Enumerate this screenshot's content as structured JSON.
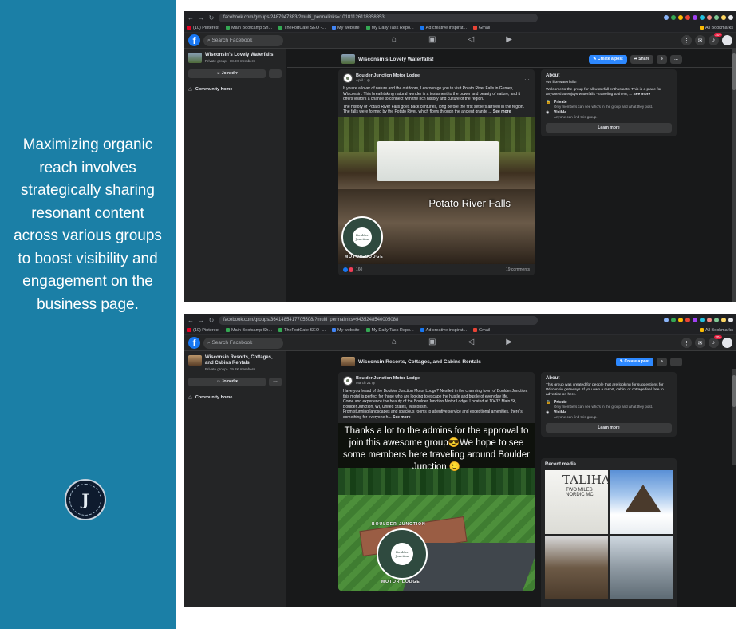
{
  "caption": "Maximizing organic reach involves strategically sharing resonant content across various groups to boost visibility and engagement on the business page.",
  "colors": {
    "panel": "#1b7fa6",
    "fb_blue": "#1877f2",
    "dark_bg": "#18191a",
    "card": "#242526"
  },
  "screenshot1": {
    "url": "facebook.com/groups/2487947383/?multi_permalinks=10181126118858853",
    "search_placeholder": "Search Facebook",
    "notif_count": "20+",
    "sidebar": {
      "group_name": "Wisconsin's Lovely Waterfalls!",
      "group_meta": "Private group · 18.9K members",
      "joined_label": "Joined",
      "community_home": "Community home"
    },
    "header": {
      "group_name": "Wisconsin's Lovely Waterfalls!",
      "create_post": "Create a post",
      "share": "Share"
    },
    "post": {
      "author": "Boulder Junction Motor Lodge",
      "date": "April 1",
      "text1": "If you're a lover of nature and the outdoors, I encourage you to visit Potato River Falls in Gurney, Wisconsin. This breathtaking natural wonder is a testament to the power and beauty of nature, and it offers visitors a chance to connect with the rich history and culture of the region.",
      "text2": "The history of Potato River Falls goes back centuries, long before the first settlers arrived in the region. The falls were formed by the Potato River, which flows through the ancient granite ...",
      "see_more": "See more",
      "photo_label": "Potato River Falls",
      "reactions": "160",
      "comments": "19 comments"
    },
    "about": {
      "title": "About",
      "greeting": "We like waterfalls!",
      "desc": "Welcome to the group for all waterfall enthusiasts! This is a place for anyone that enjoys waterfalls - traveling to them, ...",
      "see_more": "See more",
      "private_title": "Private",
      "private_desc": "Only members can see who's in the group and what they post.",
      "visible_title": "Visible",
      "visible_desc": "Anyone can find this group.",
      "learn_more": "Learn more"
    }
  },
  "screenshot2": {
    "url": "facebook.com/groups/3641485417705508/?multi_permalinks=9435248540005088",
    "search_placeholder": "Search Facebook",
    "notif_count": "20+",
    "sidebar": {
      "group_name": "Wisconsin Resorts, Cottages, and Cabins Rentals",
      "group_meta": "Private group · 19.2K members",
      "joined_label": "Joined",
      "community_home": "Community home"
    },
    "header": {
      "group_name": "Wisconsin Resorts, Cottages, and Cabins Rentals",
      "create_post": "Create a post"
    },
    "post": {
      "author": "Boulder Junction Motor Lodge",
      "date": "March 21",
      "text1": "Have you heard of the Boulder Junction Motor Lodge? Nestled in the charming town of Boulder Junction, this motel is perfect for those who are looking to escape the hustle and bustle of everyday life.",
      "text2": "Come and experience the beauty of the Boulder Junction Motor Lodge! Located at 10432 Main St, Boulder Junction, WI, United States, Wisconsin.",
      "text3": "From stunning landscapes and spacious rooms to attentive service and exceptional amenities, there's something for everyone h...",
      "see_more": "See more",
      "photo_caption": "Thanks a lot to the admins for the approval to join this awesome group😎We hope to see some members here traveling around Boulder Junction 🙂"
    },
    "about": {
      "title": "About",
      "desc": "This group was created for people that are looking for suggestions for Wisconsin getaways. If you own a resort, cabin, or cottage feel free to advertise on here.",
      "private_title": "Private",
      "private_desc": "Only members can see who's in the group and what they post.",
      "visible_title": "Visible",
      "visible_desc": "Anyone can find this group.",
      "learn_more": "Learn more"
    },
    "recent_media": {
      "title": "Recent media",
      "tile1_text": "TALIHA",
      "tile1_sub": "TWO MILES NORDIC MC"
    }
  },
  "bookmarks": [
    "(10) Pinterest",
    "Main Bootcamp Sh...",
    "TheFortCafe SEO -...",
    "My website",
    "My Daily Task Repo...",
    "Ad creative inspirat...",
    "Gmail"
  ],
  "bookmarks_right": "All Bookmarks",
  "lodge_badge": {
    "top": "BOULDER JUNCTION",
    "bottom": "MOTOR LODGE",
    "center": "Boulder Junction",
    "year": "1908"
  }
}
